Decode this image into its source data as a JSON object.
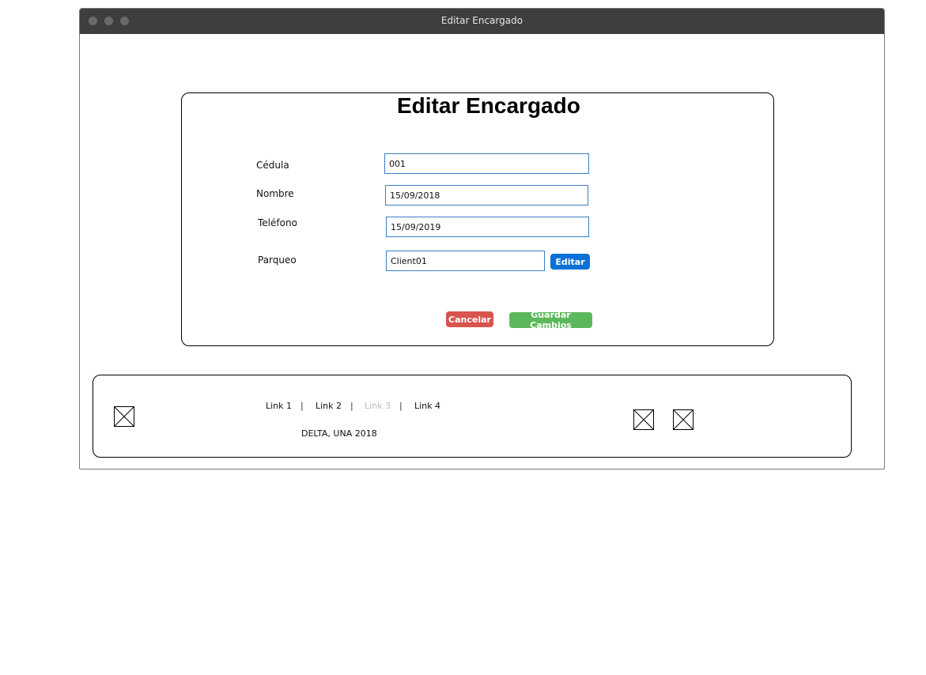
{
  "window": {
    "title": "Editar Encargado"
  },
  "form": {
    "title": "Editar Encargado",
    "fields": [
      {
        "label": "Cédula",
        "value": "001"
      },
      {
        "label": "Nombre",
        "value": "15/09/2018"
      },
      {
        "label": "Teléfono",
        "value": "15/09/2019"
      },
      {
        "label": "Parqueo",
        "value": "Client01"
      }
    ],
    "edit_button": "Editar",
    "cancel_button": "Cancelar",
    "save_button": "Guardar Cambios",
    "colors": {
      "field_border": "#3a7fc7",
      "edit": "#0a72d6",
      "cancel": "#d9534f",
      "save": "#5cb85c"
    }
  },
  "footer": {
    "links": [
      {
        "label": "Link 1",
        "disabled": false
      },
      {
        "label": "Link 2",
        "disabled": false
      },
      {
        "label": "Link 3",
        "disabled": true
      },
      {
        "label": "Link 4",
        "disabled": false
      }
    ],
    "separator": "|",
    "copyright": "DELTA, UNA 2018",
    "icons": [
      "image-placeholder-icon",
      "image-placeholder-icon",
      "image-placeholder-icon"
    ]
  }
}
